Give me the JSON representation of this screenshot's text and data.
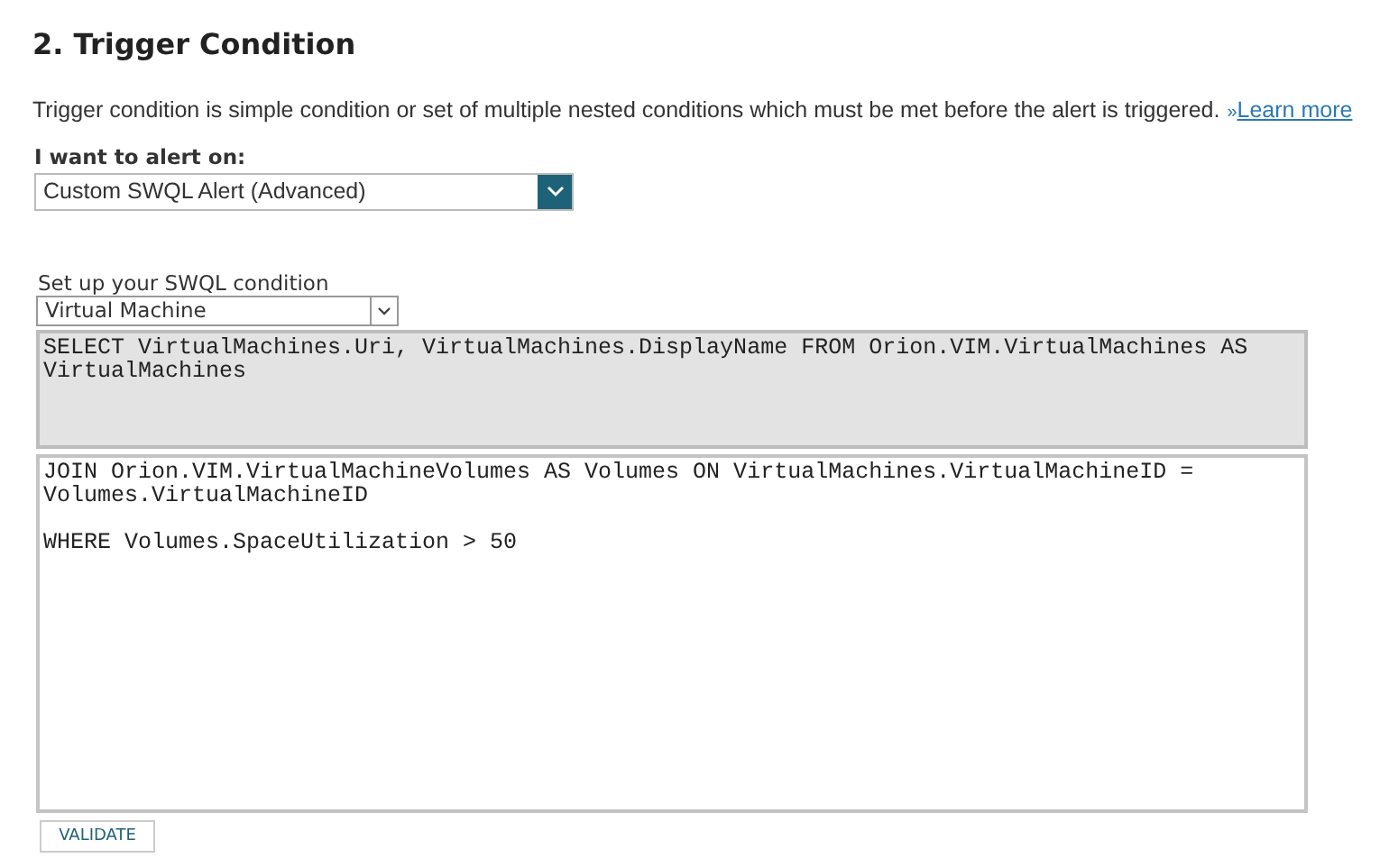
{
  "title": "2. Trigger Condition",
  "description": "Trigger condition is simple condition or set of multiple nested conditions which must be met before the alert is triggered.",
  "learn_more": {
    "prefix": "»",
    "label": "Learn more"
  },
  "alert_on": {
    "label": "I want to alert on:",
    "value": "Custom SWQL Alert (Advanced)"
  },
  "swql": {
    "label": "Set up your SWQL condition",
    "object_type": "Virtual Machine",
    "select_query": "SELECT VirtualMachines.Uri, VirtualMachines.DisplayName FROM Orion.VIM.VirtualMachines AS VirtualMachines",
    "condition_lines": [
      "JOIN Orion.VIM.VirtualMachineVolumes AS Volumes ON VirtualMachines.VirtualMachineID = Volumes.VirtualMachineID",
      "WHERE Volumes.SpaceUtilization > 50"
    ]
  },
  "buttons": [
    "VALIDATE"
  ]
}
